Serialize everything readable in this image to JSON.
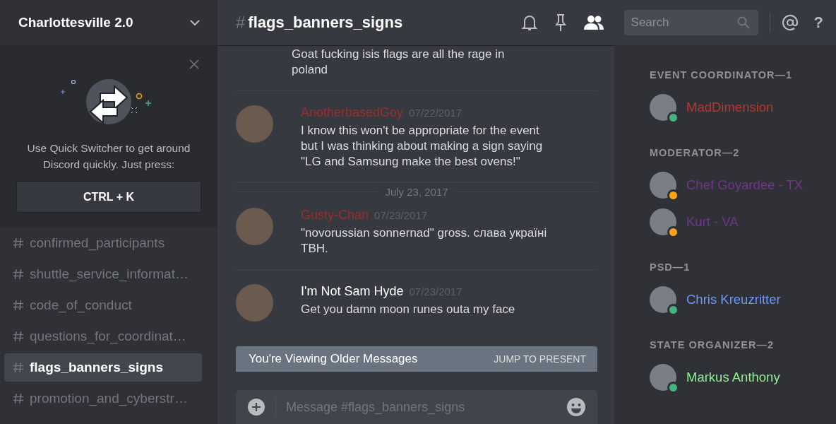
{
  "server": {
    "name": "Charlottesville 2.0"
  },
  "quick_switcher": {
    "text": "Use Quick Switcher to get around Discord quickly. Just press:",
    "shortcut": "CTRL + K"
  },
  "channels": [
    {
      "name": "confirmed_participants",
      "selected": false
    },
    {
      "name": "shuttle_service_informat…",
      "selected": false
    },
    {
      "name": "code_of_conduct",
      "selected": false
    },
    {
      "name": "questions_for_coordinat…",
      "selected": false
    },
    {
      "name": "flags_banners_signs",
      "selected": true
    },
    {
      "name": "promotion_and_cyberstr…",
      "selected": false
    }
  ],
  "header": {
    "hash": "#",
    "channel": "flags_banners_signs",
    "search_placeholder": "Search",
    "help": "?"
  },
  "messages": [
    {
      "kind": "continuation",
      "text": "Goat fucking isis flags are all the rage in poland"
    },
    {
      "kind": "message",
      "author": "AnotherbasedGoy",
      "color": "#9a2e2e",
      "date": "07/22/2017",
      "text": "I know this won't be appropriate for the event but I was thinking about making a sign saying \"LG and Samsung make the best ovens!\""
    },
    {
      "kind": "divider",
      "text": "July 23, 2017"
    },
    {
      "kind": "message",
      "author": "Gusty-Chan",
      "color": "#9a2e2e",
      "date": "07/23/2017",
      "text": "\"novorussian sonnernad\" gross. слава україні ТВН."
    },
    {
      "kind": "message",
      "author": "I'm Not Sam Hyde",
      "color": "#ffffff",
      "date": "07/23/2017",
      "text": "Get you damn moon runes outa my face"
    }
  ],
  "banner": {
    "text": "You're Viewing Older Messages",
    "action": "JUMP TO PRESENT"
  },
  "composer": {
    "placeholder": "Message #flags_banners_signs"
  },
  "member_groups": [
    {
      "title": "EVENT COORDINATOR—1",
      "members": [
        {
          "name": "MadDimension",
          "color": "#b5372f",
          "status_dot": {
            "color": "#43b581"
          }
        }
      ]
    },
    {
      "title": "MODERATOR—2",
      "members": [
        {
          "name": "Chef Goyardee - TX",
          "color": "#71368a",
          "status_dot": {
            "color": "#faa61a"
          }
        },
        {
          "name": "Kurt - VA",
          "color": "#71368a",
          "status_dot": {
            "color": "#faa61a"
          }
        }
      ]
    },
    {
      "title": "PSD—1",
      "members": [
        {
          "name": "Chris Kreuzritter",
          "color": "#6d97f0",
          "status_dot": {
            "color": "#43b581"
          }
        }
      ]
    },
    {
      "title": "STATE ORGANIZER—2",
      "members": [
        {
          "name": "Markus Anthony",
          "color": "#8ef08e",
          "status_dot": {
            "color": "#43b581"
          }
        }
      ]
    }
  ]
}
